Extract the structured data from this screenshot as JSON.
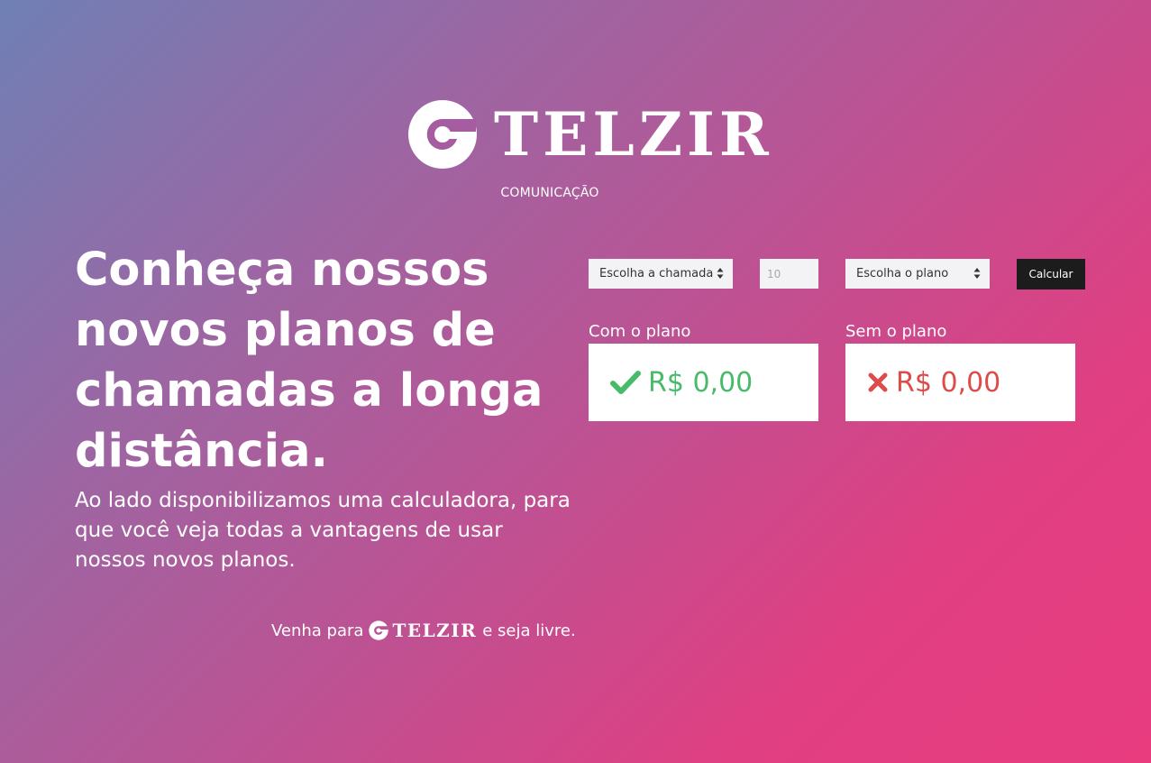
{
  "brand": {
    "name": "TELZIR",
    "tagline": "COMUNICAÇÃO",
    "colors": {
      "positive": "#48bb6a",
      "negative": "#dd4b4b",
      "button": "#1c1c1c"
    }
  },
  "hero": {
    "title": "Conheça nossos novos planos de chamadas a longa distância.",
    "description": "Ao lado disponibilizamos uma calculadora, para que você veja todas a vantagens de usar nossos novos planos."
  },
  "slogan": {
    "before": "Venha para",
    "brand": "TELZIR",
    "after": "e seja livre."
  },
  "calculator": {
    "call_select": {
      "selected": "Escolha a chamada",
      "icon": "sort-caret-icon"
    },
    "minutes_input": {
      "placeholder": "10",
      "value": ""
    },
    "plan_select": {
      "selected": "Escolha o plano",
      "icon": "sort-caret-icon"
    },
    "calculate_label": "Calcular"
  },
  "results": {
    "with_plan": {
      "label": "Com o plano",
      "value": "R$ 0,00",
      "icon": "check-icon"
    },
    "without_plan": {
      "label": "Sem o plano",
      "value": "R$ 0,00",
      "icon": "x-icon"
    }
  }
}
